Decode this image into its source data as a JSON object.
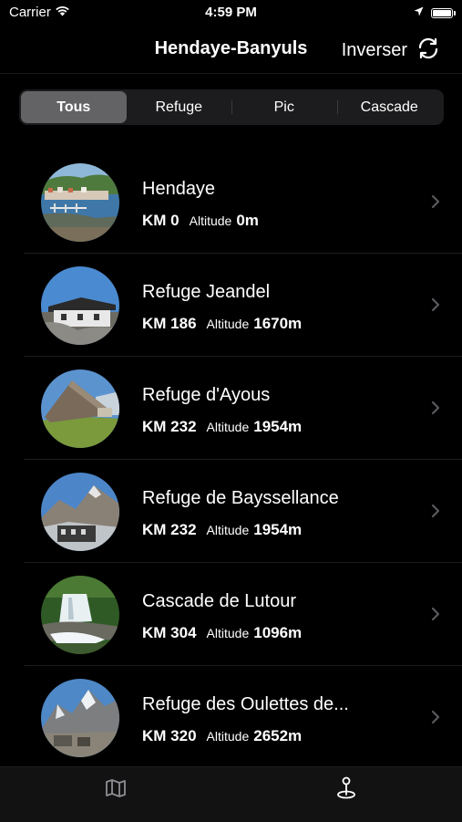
{
  "status_bar": {
    "carrier": "Carrier",
    "time": "4:59 PM",
    "battery_level": 1.0
  },
  "nav": {
    "title": "Hendaye-Banyuls",
    "action_label": "Inverser",
    "action_icon": "refresh-icon"
  },
  "segments": [
    {
      "label": "Tous",
      "selected": true
    },
    {
      "label": "Refuge",
      "selected": false
    },
    {
      "label": "Pic",
      "selected": false
    },
    {
      "label": "Cascade",
      "selected": false
    }
  ],
  "items": [
    {
      "title": "Hendaye",
      "km": "KM 0",
      "altitude_label": "Altitude",
      "altitude": "0m"
    },
    {
      "title": "Refuge Jeandel",
      "km": "KM 186",
      "altitude_label": "Altitude",
      "altitude": "1670m"
    },
    {
      "title": "Refuge d'Ayous",
      "km": "KM 232",
      "altitude_label": "Altitude",
      "altitude": "1954m"
    },
    {
      "title": "Refuge de Bayssellance",
      "km": "KM 232",
      "altitude_label": "Altitude",
      "altitude": "1954m"
    },
    {
      "title": "Cascade de Lutour",
      "km": "KM 304",
      "altitude_label": "Altitude",
      "altitude": "1096m"
    },
    {
      "title": "Refuge des Oulettes de...",
      "km": "KM 320",
      "altitude_label": "Altitude",
      "altitude": "2652m"
    }
  ],
  "tab_bar": {
    "tabs": [
      {
        "icon": "map-icon",
        "selected": false
      },
      {
        "icon": "location-pin-icon",
        "selected": true
      }
    ]
  },
  "colors": {
    "background": "#000000",
    "segment_bg": "#1c1c1e",
    "segment_selected": "#636366",
    "separator": "#1c1c1e",
    "chevron": "#5a5a5e",
    "tab_inactive": "#8e8e93"
  }
}
